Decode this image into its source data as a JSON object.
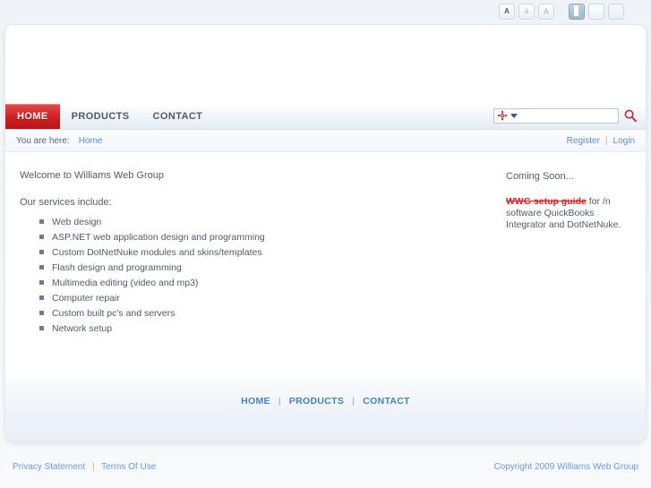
{
  "toolbar": {
    "text_size_buttons": [
      {
        "name": "text-size-small",
        "label": "A"
      },
      {
        "name": "text-size-medium",
        "label": "A"
      },
      {
        "name": "text-size-large",
        "label": "A"
      }
    ],
    "layout_buttons": [
      {
        "name": "layout-two-column",
        "label": ""
      },
      {
        "name": "layout-wide",
        "label": ""
      },
      {
        "name": "layout-full",
        "label": ""
      }
    ]
  },
  "nav": {
    "items": [
      {
        "label": "HOME",
        "selected": true
      },
      {
        "label": "PRODUCTS",
        "selected": false
      },
      {
        "label": "CONTACT",
        "selected": false
      }
    ]
  },
  "search": {
    "value": "",
    "placeholder": "",
    "scope_icon": "site-search-gear-icon",
    "go_icon": "magnifier-icon"
  },
  "breadcrumb": {
    "prefix": "You are here:",
    "current": "Home"
  },
  "account": {
    "register": "Register",
    "separator": "|",
    "login": "Login"
  },
  "main": {
    "welcome": "Welcome to Williams Web Group",
    "services_lead": "Our services include:",
    "services": [
      "Web design",
      "ASP.NET web application design and programming",
      "Custom DotNetNuke modules and skins/templates",
      "Flash design and programming",
      "Multimedia editing (video and mp3)",
      "Computer repair",
      "Custom built pc's and servers",
      "Network setup"
    ]
  },
  "sidebar": {
    "title": "Coming Soon...",
    "highlight": "WWG setup guide",
    "body": " for /n software QuickBooks Integrator and DotNetNuke."
  },
  "footer": {
    "links": [
      {
        "label": "HOME"
      },
      {
        "label": "PRODUCTS"
      },
      {
        "label": "CONTACT"
      }
    ],
    "separator": "|"
  },
  "legal": {
    "privacy": "Privacy Statement",
    "separator": "|",
    "terms": "Terms Of Use",
    "copyright": "Copyright 2009 Williams Web Group"
  },
  "colors": {
    "accent_red": "#cf1f22",
    "link_blue": "#5b8ec9",
    "footer_blue": "#4a7fbf",
    "highlight_red": "#e02020",
    "page_bg": "#eff3f8"
  }
}
